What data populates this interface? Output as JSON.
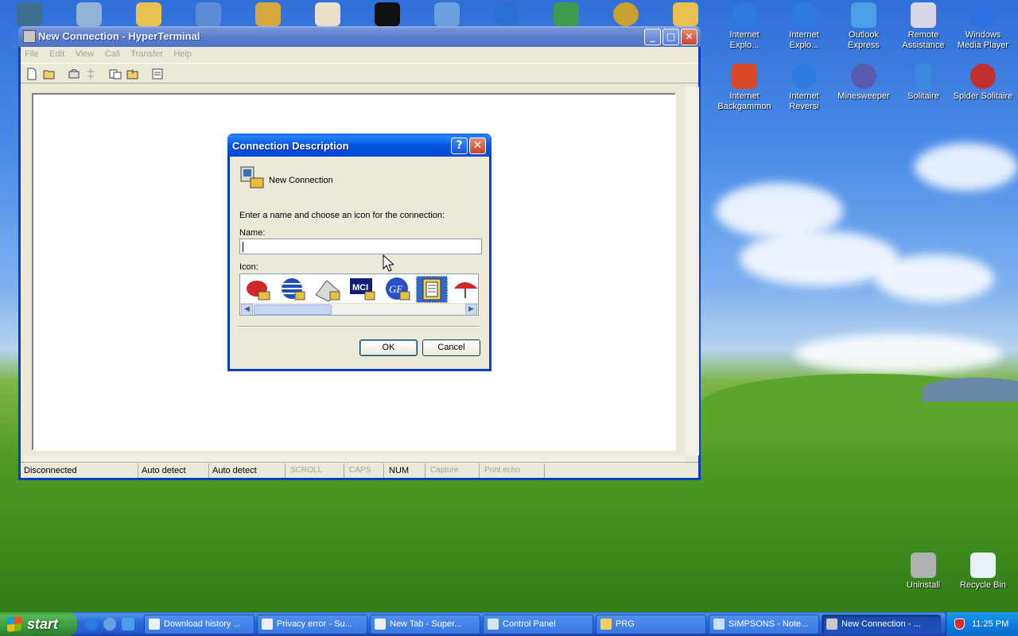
{
  "desktop": {
    "right_icons": [
      {
        "label": "Internet Explo...",
        "color": "#2b7be0"
      },
      {
        "label": "Internet Explo...",
        "color": "#2b7be0"
      },
      {
        "label": "Outlook Express",
        "color": "#4aa0e8"
      },
      {
        "label": "Remote Assistance",
        "color": "#d8d8e8"
      },
      {
        "label": "Windows Media Player",
        "color": "#2e6fe0"
      },
      {
        "label": "Internet Backgammon",
        "color": "#d84a2a"
      },
      {
        "label": "Internet Reversi",
        "color": "#2b7be0"
      },
      {
        "label": "Minesweeper",
        "color": "#5a5ab0"
      },
      {
        "label": "Solitaire",
        "color": "#3c8adf"
      },
      {
        "label": "Spider Solitaire",
        "color": "#c03030"
      }
    ],
    "bottom_icons": [
      {
        "label": "Uninstall",
        "color": "#b0b0b0"
      },
      {
        "label": "Recycle Bin",
        "color": "#e8f0f8"
      }
    ]
  },
  "window": {
    "title": "New Connection - HyperTerminal",
    "menu": [
      "File",
      "Edit",
      "View",
      "Call",
      "Transfer",
      "Help"
    ],
    "status": {
      "connection": "Disconnected",
      "detect1": "Auto detect",
      "detect2": "Auto detect",
      "scroll": "SCROLL",
      "caps": "CAPS",
      "num": "NUM",
      "capture": "Capture",
      "print_echo": "Print echo"
    }
  },
  "dialog": {
    "title": "Connection Description",
    "help_label": "?",
    "close_label": "✕",
    "connection_name": "New Connection",
    "instruction": "Enter a name and choose an icon for the connection:",
    "name_label": "Name:",
    "name_value": "",
    "icon_label": "Icon:",
    "icons": [
      "phone-red",
      "globe-blue",
      "fax",
      "MCI",
      "GE",
      "folder-doc",
      "phone-umbrella"
    ],
    "ok_label": "OK",
    "cancel_label": "Cancel"
  },
  "taskbar": {
    "start_label": "start",
    "tasks": [
      {
        "label": "Download history ...",
        "active": false
      },
      {
        "label": "Privacy error - Su...",
        "active": false
      },
      {
        "label": "New Tab - Super...",
        "active": false
      },
      {
        "label": "Control Panel",
        "active": false
      },
      {
        "label": "PRG",
        "active": false
      },
      {
        "label": "SIMPSONS - Note...",
        "active": false
      },
      {
        "label": "New Connection - ...",
        "active": true
      }
    ],
    "clock": "11:25 PM"
  }
}
